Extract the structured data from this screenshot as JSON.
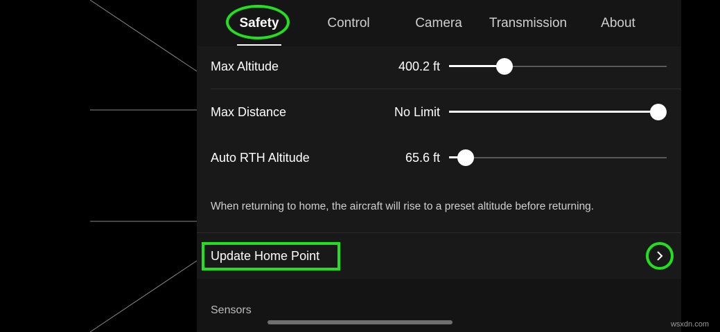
{
  "tabs": [
    {
      "label": "Safety",
      "active": true
    },
    {
      "label": "Control",
      "active": false
    },
    {
      "label": "Camera",
      "active": false
    },
    {
      "label": "Transmission",
      "active": false
    },
    {
      "label": "About",
      "active": false
    }
  ],
  "settings": [
    {
      "label": "Max Altitude",
      "value": "400.2 ft",
      "slider_fraction": 0.235
    },
    {
      "label": "Max Distance",
      "value": "No Limit",
      "slider_fraction": 1.0
    },
    {
      "label": "Auto RTH Altitude",
      "value": "65.6 ft",
      "slider_fraction": 0.04
    }
  ],
  "rth_description": "When returning to home, the aircraft will rise to a preset altitude before returning.",
  "home_point": {
    "label": "Update Home Point",
    "icon": "chevron-right-icon"
  },
  "section_header": "Sensors",
  "watermark": "wsxdn.com",
  "colors": {
    "highlight": "#22e01e",
    "panel_bg": "#191919"
  }
}
